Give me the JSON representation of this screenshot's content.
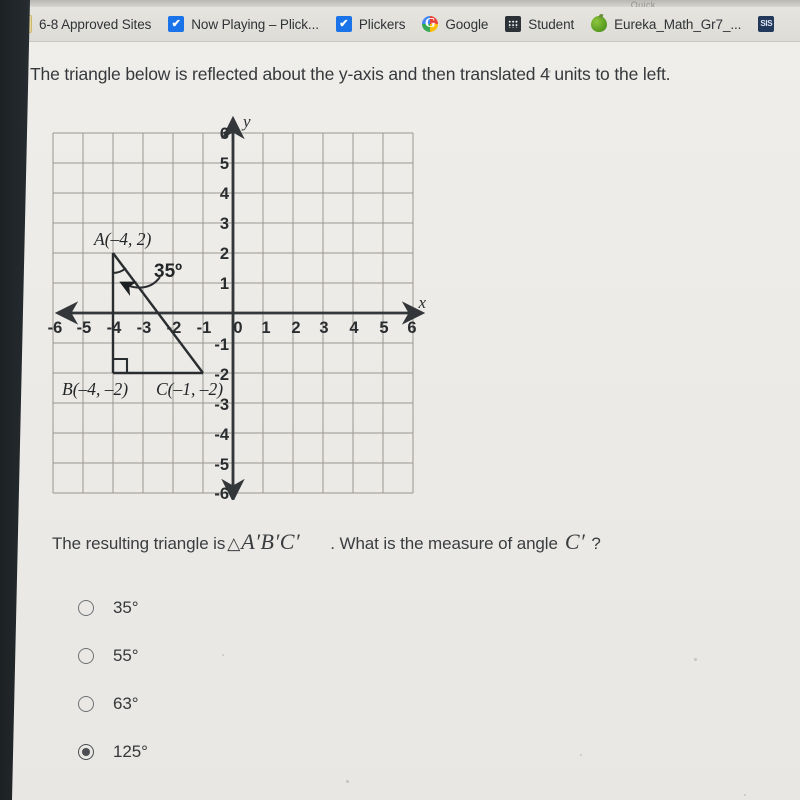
{
  "browser": {
    "bookmarks": [
      {
        "label": "6-8 Approved Sites",
        "icon": "folder-icon",
        "icon_class": "ic-folder",
        "glyph": ""
      },
      {
        "label": "Now Playing – Plick...",
        "icon": "checkbox-icon",
        "icon_class": "ic-check",
        "glyph": "✔"
      },
      {
        "label": "Plickers",
        "icon": "checkbox-icon",
        "icon_class": "ic-check",
        "glyph": "✔"
      },
      {
        "label": "Google",
        "icon": "google-icon",
        "icon_class": "ic-google",
        "glyph": ""
      },
      {
        "label": "Student",
        "icon": "grid-dots-icon",
        "icon_class": "ic-grid",
        "glyph": ""
      },
      {
        "label": "Eureka_Math_Gr7_...",
        "icon": "apple-icon",
        "icon_class": "ic-apple",
        "glyph": ""
      },
      {
        "label": "",
        "icon": "sis-icon",
        "icon_class": "ic-sis",
        "glyph": "SIS"
      }
    ],
    "cutoff_tab_text": "...Quick"
  },
  "question": {
    "prompt": "The triangle below is reflected about the y-axis and then translated 4 units to the left.",
    "followup_pre": "The resulting triangle is",
    "followup_triangle_symbol": "△",
    "followup_label": "A′B′C′",
    "followup_mid": ". What is the measure of angle",
    "followup_angle": "C′",
    "followup_end": "?"
  },
  "options": [
    {
      "label": "35°",
      "selected": false
    },
    {
      "label": "55°",
      "selected": false
    },
    {
      "label": "63°",
      "selected": false
    },
    {
      "label": "125°",
      "selected": true
    }
  ],
  "chart_data": {
    "type": "scatter",
    "title": "",
    "xlabel": "x",
    "ylabel": "y",
    "xlim": [
      -6,
      6
    ],
    "ylim": [
      -6,
      6
    ],
    "grid": true,
    "x_ticks": [
      -6,
      -5,
      -4,
      -3,
      -2,
      -1,
      0,
      1,
      2,
      3,
      4,
      5,
      6
    ],
    "y_ticks": [
      -6,
      -5,
      -4,
      -3,
      -2,
      -1,
      1,
      2,
      3,
      4,
      5,
      6
    ],
    "x_tick_labels": [
      "-6",
      "-5",
      "-4",
      "-3",
      "-2",
      "-1",
      "0",
      "1",
      "2",
      "3",
      "4",
      "5",
      "6"
    ],
    "y_tick_labels": [
      "-6",
      "-5",
      "-4",
      "-3",
      "-2",
      "-1",
      "1",
      "2",
      "3",
      "4",
      "5",
      "6"
    ],
    "shapes": [
      {
        "name": "triangle-ABC",
        "type": "polygon",
        "vertices": [
          {
            "label": "A",
            "x": -4,
            "y": 2,
            "annotation": "A(–4, 2)"
          },
          {
            "label": "B",
            "x": -4,
            "y": -2,
            "annotation": "B(–4, –2)"
          },
          {
            "label": "C",
            "x": -1,
            "y": -2,
            "annotation": "C(–1, –2)"
          }
        ],
        "right_angle_at": "B",
        "angle_label": {
          "at": "A",
          "value": "35º"
        }
      }
    ],
    "annotations": [
      {
        "text": "A(–4, 2)",
        "x": -4.6,
        "y": 2.55
      },
      {
        "text": "35º",
        "x": -2.6,
        "y": 1.55
      },
      {
        "text": "B(–4, –2)",
        "x": -5.6,
        "y": -2.55
      },
      {
        "text": "C(–1, –2)",
        "x": -2.5,
        "y": -2.55
      }
    ],
    "axis_arrow_labels": {
      "x": "x",
      "y": "y"
    }
  }
}
